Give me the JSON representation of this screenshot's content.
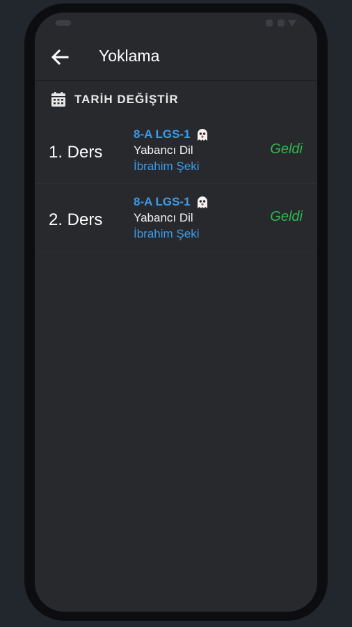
{
  "app": {
    "title": "Yoklama"
  },
  "actions": {
    "change_date_label": "TARİH DEĞİŞTİR"
  },
  "icons": {
    "back": "arrow-left-icon",
    "calendar": "calendar-icon",
    "ghost": "ghost-icon"
  },
  "colors": {
    "accent_blue": "#3d9be9",
    "present_green": "#2eb84f",
    "background": "#27292d"
  },
  "lessons": [
    {
      "lesson": "1. Ders",
      "class_name": "8-A LGS-1",
      "subject": "Yabancı Dil",
      "teacher": "İbrahim Şeki",
      "status": "Geldi"
    },
    {
      "lesson": "2. Ders",
      "class_name": "8-A LGS-1",
      "subject": "Yabancı Dil",
      "teacher": "İbrahim Şeki",
      "status": "Geldi"
    }
  ]
}
